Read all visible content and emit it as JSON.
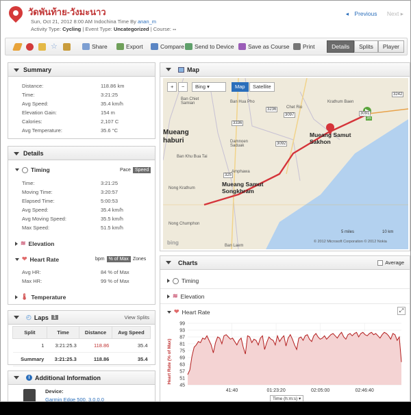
{
  "header": {
    "title": "วัดพันท้าย-วังมะนาว",
    "date_line_prefix": "Sun, Oct 21, 2012 8:00 AM Indochina Time By",
    "user": "anan_m",
    "activity_type_label": "Activity Type:",
    "activity_type": "Cycling",
    "event_type_label": "Event Type:",
    "event_type": "Uncategorized",
    "course_label": "Course:",
    "course": "--",
    "prev": "Previous",
    "next": "Next"
  },
  "toolbar": {
    "share": "Share",
    "export": "Export",
    "compare": "Compare",
    "send": "Send to Device",
    "save_course": "Save as Course",
    "print": "Print",
    "tabs": [
      "Details",
      "Splits",
      "Player"
    ]
  },
  "summary": {
    "title": "Summary",
    "rows": [
      {
        "label": "Distance:",
        "value": "118.86 km"
      },
      {
        "label": "Time:",
        "value": "3:21:25"
      },
      {
        "label": "Avg Speed:",
        "value": "35.4 km/h"
      },
      {
        "label": "Elevation Gain:",
        "value": "154 m"
      },
      {
        "label": "Calories:",
        "value": "2,107 C"
      },
      {
        "label": "Avg Temperature:",
        "value": "35.6 °C"
      }
    ]
  },
  "details": {
    "title": "Details",
    "timing": {
      "title": "Timing",
      "pace": "Pace",
      "speed": "Speed",
      "rows": [
        {
          "label": "Time:",
          "value": "3:21:25"
        },
        {
          "label": "Moving Time:",
          "value": "3:20:57"
        },
        {
          "label": "Elapsed Time:",
          "value": "5:00:53"
        },
        {
          "label": "Avg Speed:",
          "value": "35.4 km/h"
        },
        {
          "label": "Avg Moving Speed:",
          "value": "35.5 km/h"
        },
        {
          "label": "Max Speed:",
          "value": "51.5 km/h"
        }
      ]
    },
    "elevation": "Elevation",
    "heart_rate": {
      "title": "Heart Rate",
      "bpm": "bpm",
      "pct": "% of Max",
      "zones": "Zones",
      "rows": [
        {
          "label": "Avg HR:",
          "value": "84 % of Max"
        },
        {
          "label": "Max HR:",
          "value": "99 % of Max"
        }
      ]
    },
    "temperature": "Temperature"
  },
  "laps": {
    "title": "Laps",
    "count": "1",
    "view_splits": "View Splits",
    "headers": [
      "Split",
      "Time",
      "Distance",
      "Avg Speed"
    ],
    "rows": [
      [
        "1",
        "3:21:25.3",
        "118.86",
        "35.4"
      ],
      [
        "Summary",
        "3:21:25.3",
        "118.86",
        "35.4"
      ]
    ]
  },
  "additional": {
    "title": "Additional Information",
    "device_label": "Device:",
    "device": "Garmin Edge 500, 3.0.0.0"
  },
  "map": {
    "title": "Map",
    "provider": "Bing",
    "map_btn": "Map",
    "satellite_btn": "Satellite",
    "labels": [
      "Mueang Samut Sakhon",
      "Mueang Samut Songkhram",
      "Mueang haburi",
      "Ban Chiet Samian",
      "Ban Hua Pho",
      "Chet Rio",
      "Krathum Baen",
      "Damnoen Saduak",
      "Ban Khu Bua Tai",
      "Amphawa",
      "Nong Krathum",
      "Nong Chumphon",
      "Ban Laem"
    ],
    "roads": [
      "3242",
      "3236",
      "3091",
      "3097",
      "3092",
      "3336",
      "325",
      "35"
    ],
    "scale1": "5 miles",
    "scale2": "10 km",
    "copyright": "© 2012 Microsoft Corporation   © 2012 Nokia",
    "bing": "bing"
  },
  "charts": {
    "title": "Charts",
    "average": "Average",
    "timing": "Timing",
    "elevation": "Elevation",
    "heart_rate": "Heart Rate",
    "time_select": "Time (h:m:s)"
  },
  "chart_data": {
    "type": "area",
    "title": "",
    "ylabel": "Heart Rate (% of Max)",
    "ylim": [
      45,
      99
    ],
    "yticks": [
      45,
      51,
      57,
      63,
      69,
      75,
      81,
      87,
      93,
      99
    ],
    "xticks": [
      "41:40",
      "01:23:20",
      "02:05:00",
      "02:46:40"
    ],
    "xrange_minutes": [
      0,
      201.4
    ],
    "series": [
      {
        "values": [
          54,
          58,
          70,
          78,
          80,
          83,
          82,
          86,
          85,
          88,
          84,
          80,
          73,
          82,
          87,
          86,
          81,
          88,
          89,
          87,
          85,
          86,
          83,
          80,
          84,
          86,
          78,
          72,
          88,
          87,
          82,
          85,
          84,
          80,
          86,
          88,
          76,
          82,
          87,
          85,
          84,
          80,
          88,
          83,
          86,
          88,
          79,
          86,
          89,
          85,
          80,
          76,
          86,
          87,
          84,
          88,
          89,
          85,
          83,
          88,
          90,
          87,
          85,
          86,
          88,
          85,
          87,
          89,
          90,
          88,
          86,
          89,
          91,
          87,
          85,
          89,
          90,
          88,
          90,
          91,
          87,
          90,
          91,
          89,
          88,
          90,
          91,
          89,
          90,
          88,
          86,
          89,
          91,
          90,
          88,
          85,
          90,
          89,
          84,
          87,
          65
        ]
      }
    ]
  }
}
